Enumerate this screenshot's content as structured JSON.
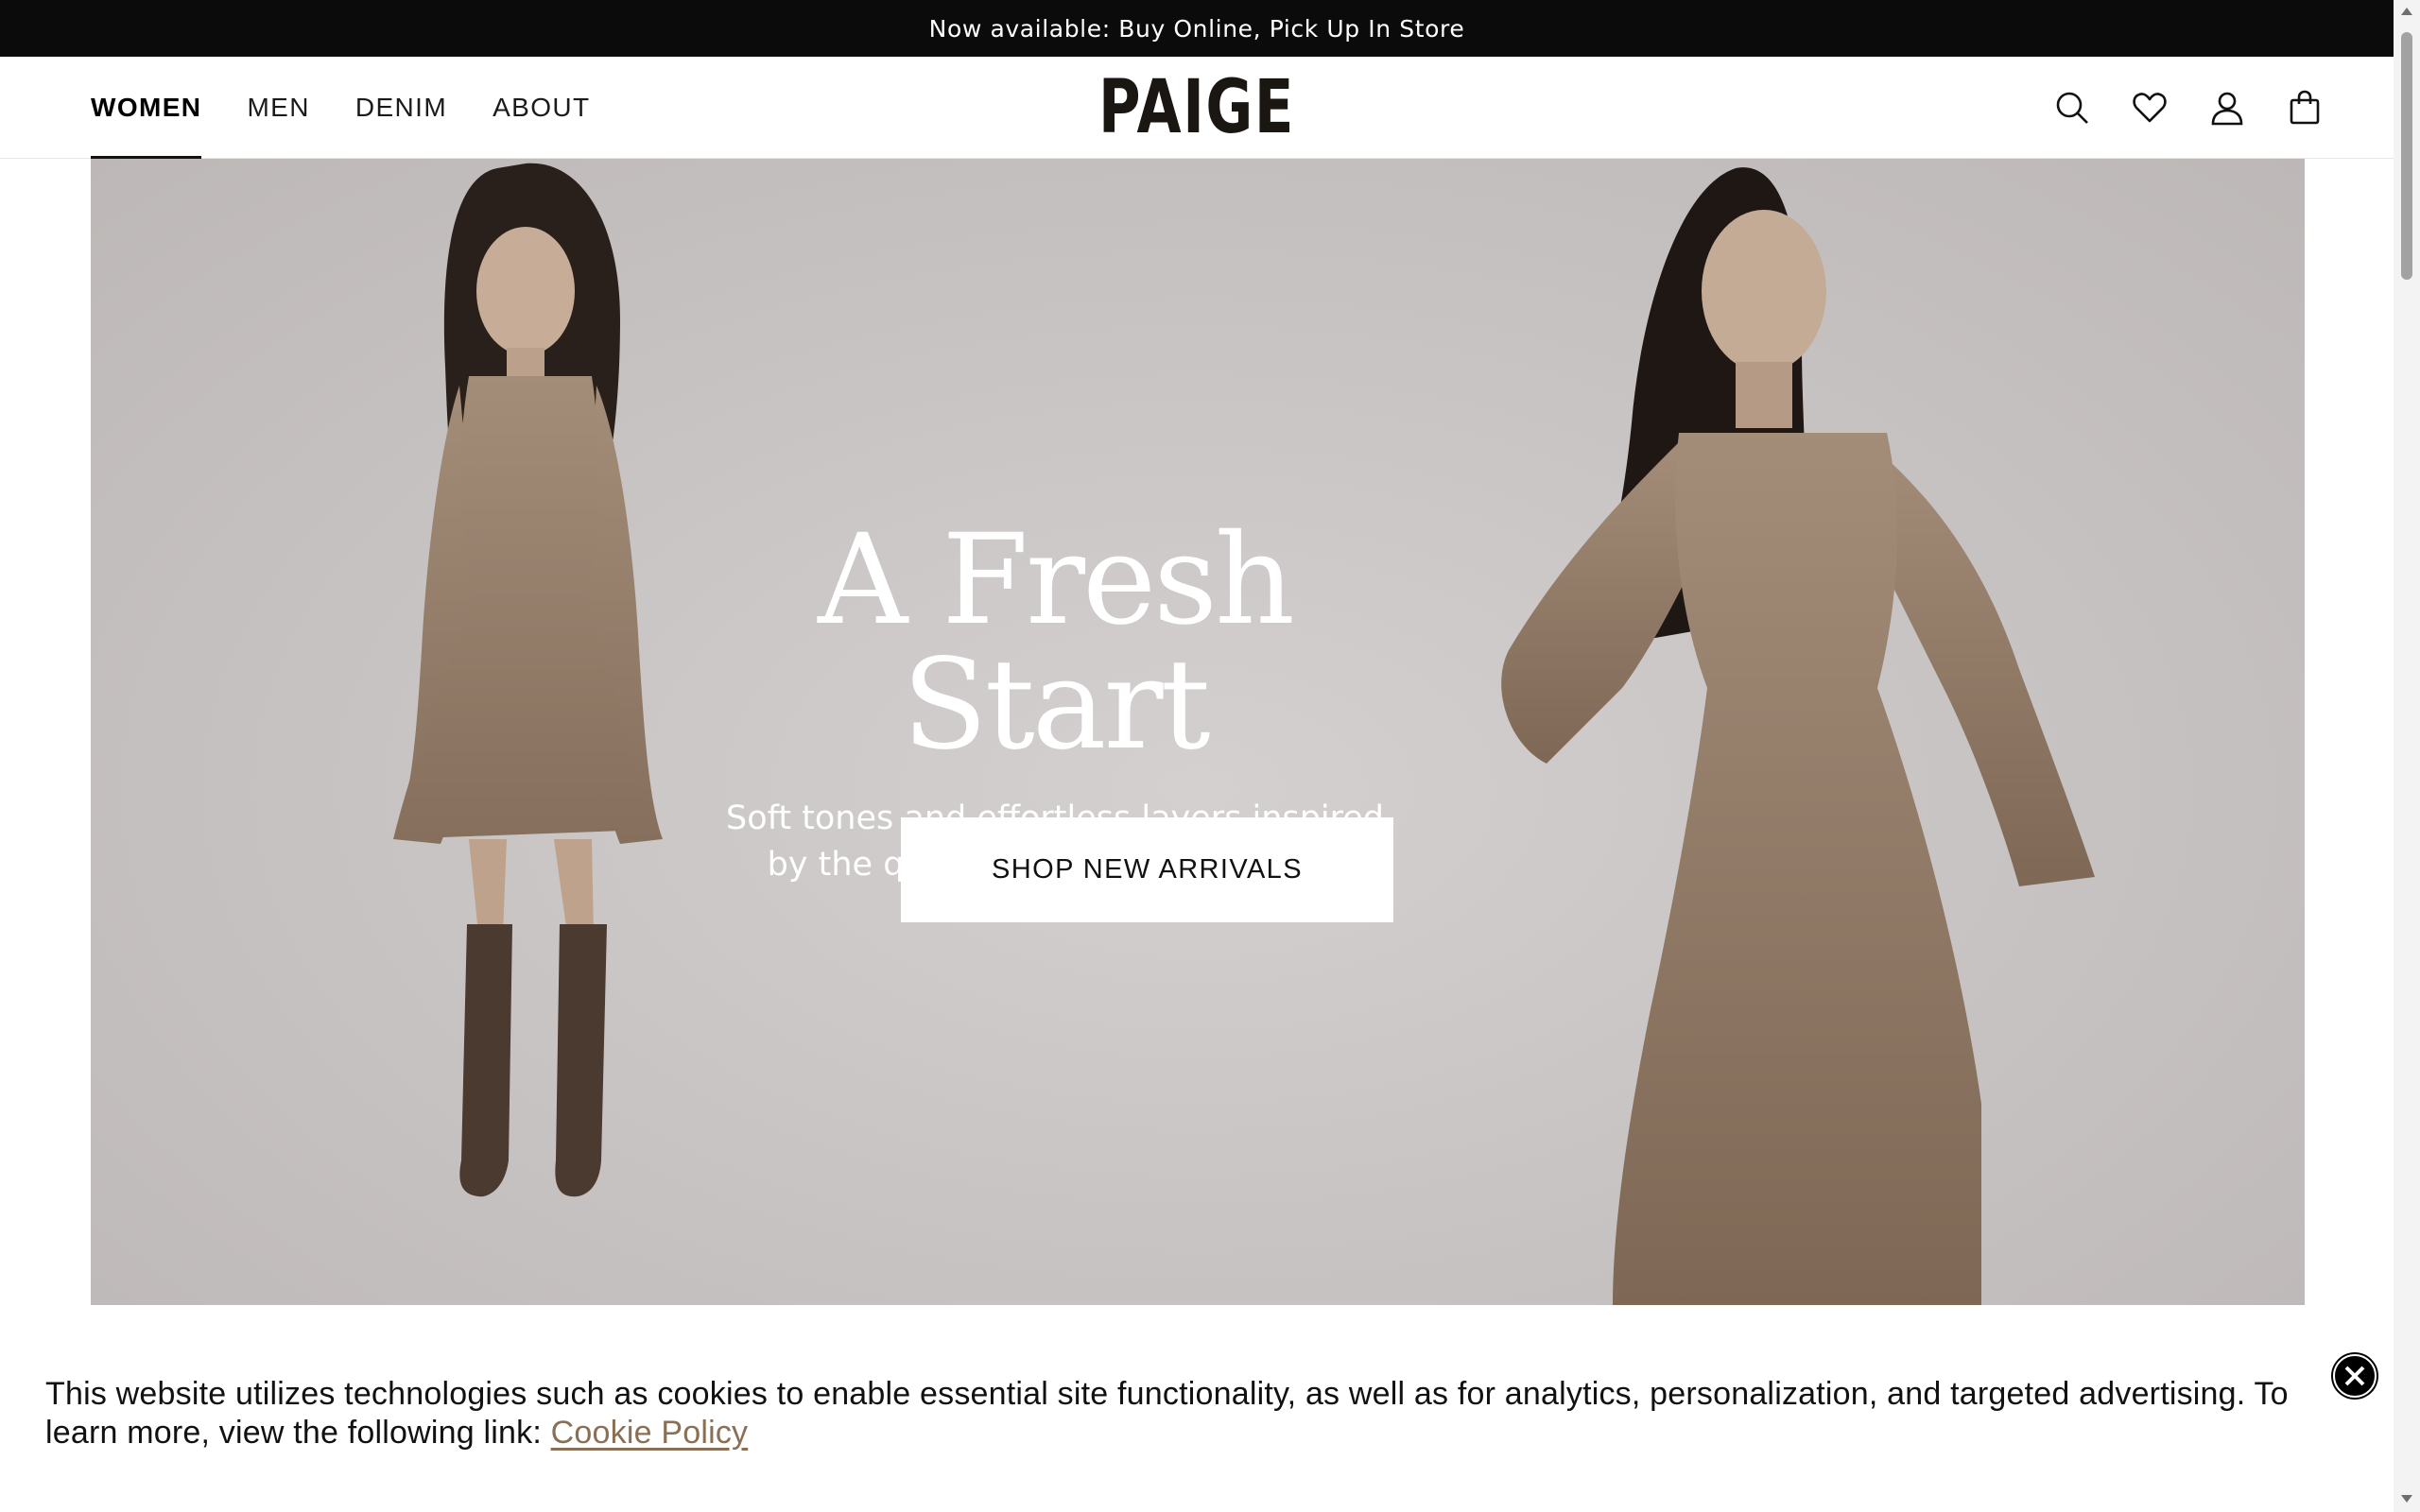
{
  "announcement": {
    "text": "Now available: Buy Online, Pick Up In Store"
  },
  "header": {
    "nav": [
      {
        "label": "WOMEN",
        "active": true
      },
      {
        "label": "MEN",
        "active": false
      },
      {
        "label": "DENIM",
        "active": false
      },
      {
        "label": "ABOUT",
        "active": false
      }
    ],
    "logo": "PAIGE",
    "icons": [
      "search-icon",
      "heart-icon",
      "account-icon",
      "bag-icon"
    ]
  },
  "hero": {
    "title": "A Fresh Start",
    "subtitle_line1": "Soft tones and effortless layers inspired",
    "subtitle_line2": "by the quiet beauty of early spring",
    "cta": "SHOP NEW ARRIVALS",
    "background_color": "#c9c5c5"
  },
  "cookie_banner": {
    "text": "This website utilizes technologies such as cookies to enable essential site functionality, as well as for analytics, personalization, and targeted advertising. To learn more, view the following link:",
    "link_text": "Cookie Policy",
    "link_color": "#8a6f55",
    "close_icon": "close-icon"
  },
  "colors": {
    "announcement_bg": "#0b0b0b",
    "text_primary": "#111111"
  }
}
